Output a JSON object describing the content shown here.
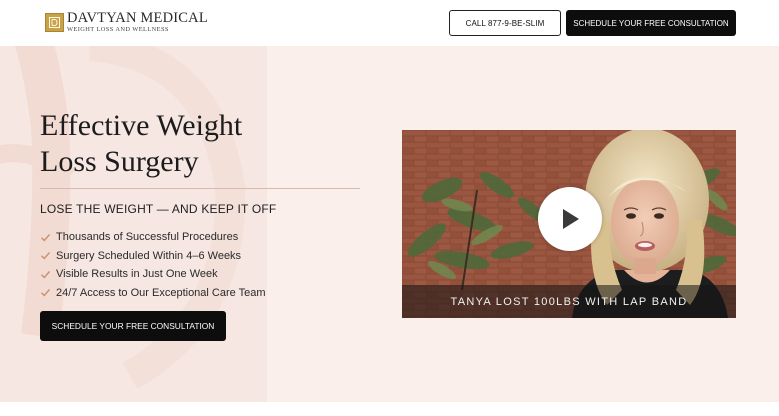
{
  "header": {
    "logo_name": "DAVTYAN MEDICAL",
    "logo_tagline": "WEIGHT LOSS AND WELLNESS",
    "call_button": "CALL 877-9-BE-SLIM",
    "consult_button": "SCHEDULE YOUR FREE CONSULTATION"
  },
  "hero": {
    "headline_line1": "Effective Weight",
    "headline_line2": "Loss Surgery",
    "subhead": "LOSE THE WEIGHT — AND KEEP IT OFF",
    "benefits": [
      "Thousands of Successful Procedures",
      "Surgery Scheduled Within 4–6 Weeks",
      "Visible Results in Just One Week",
      "24/7 Access to Our Exceptional Care Team"
    ],
    "consult_button": "SCHEDULE YOUR FREE CONSULTATION"
  },
  "video": {
    "caption": "TANYA LOST 100LBS WITH LAP BAND"
  },
  "colors": {
    "hero_background": "#fbefeb",
    "panel_background": "#f6e7e2",
    "check_accent": "#c9906f",
    "logo_gold": "#c9a14a",
    "button_dark": "#0d0d0d"
  },
  "icons": {
    "logo": "logo-emblem-icon",
    "benefit": "check-icon",
    "play": "play-icon"
  }
}
